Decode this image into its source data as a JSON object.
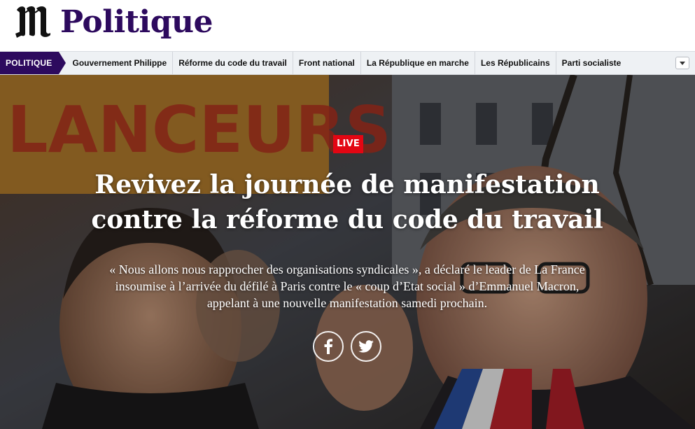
{
  "header": {
    "logo_letter": "M",
    "section_title": "Politique"
  },
  "nav": {
    "label": "POLITIQUE",
    "items": [
      "Gouvernement Philippe",
      "Réforme du code du travail",
      "Front national",
      "La République en marche",
      "Les Républicains",
      "Parti socialiste"
    ],
    "more_icon": "chevron-down-icon"
  },
  "hero": {
    "badge": "LIVE",
    "headline_line1": "Revivez la journée de manifestation",
    "headline_line2": "contre la réforme du code du travail",
    "lede_line1": "« Nous allons nous rapprocher des organisations syndicales », a déclaré le leader de La France",
    "lede_line2": "insoumise à l’arrivée du défilé à Paris contre le « coup d’Etat social » d’Emmanuel Macron,",
    "lede_line3": "appelant à une nouvelle manifestation samedi prochain.",
    "photo_banner_text": "LANCEURS",
    "share_icons": [
      "facebook-icon",
      "twitter-icon"
    ]
  },
  "colors": {
    "brand_purple": "#2d0a5e",
    "live_red": "#e30613",
    "nav_bg": "#eef1f4"
  }
}
